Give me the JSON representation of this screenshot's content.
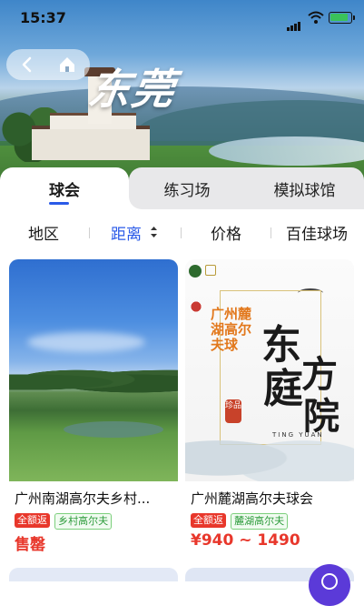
{
  "status_bar": {
    "time": "15:37"
  },
  "hero": {
    "calligraphy": "东莞"
  },
  "tabs": [
    {
      "label": "球会",
      "active": true
    },
    {
      "label": "练习场",
      "active": false
    },
    {
      "label": "模拟球馆",
      "active": false
    }
  ],
  "filters": [
    {
      "label": "地区",
      "selected": false
    },
    {
      "label": "距离",
      "selected": true
    },
    {
      "label": "价格",
      "selected": false
    },
    {
      "label": "百佳球场",
      "selected": false
    }
  ],
  "cards": [
    {
      "name": "广州南湖高尔夫乡村...",
      "tags": [
        "全额返",
        "乡村高尔夫"
      ],
      "price": "售罄"
    },
    {
      "name": "广州麓湖高尔夫球会",
      "tags": [
        "全额返",
        "麓湖高尔夫"
      ],
      "price": "¥940 ~ 1490",
      "image_text": {
        "vertical_left": "广州麓湖高尔夫球",
        "big1": "东",
        "big2": "方",
        "big3": "庭",
        "big4": "院",
        "seal": "珍品",
        "en": "TING YUAN"
      }
    }
  ],
  "colors": {
    "accent": "#2a5ae8",
    "price_red": "#e8372b",
    "tag_green": "#2d9b3b"
  }
}
